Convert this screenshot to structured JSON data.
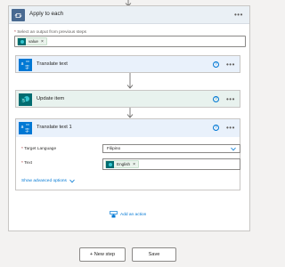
{
  "apply_to_each": {
    "title": "Apply to each",
    "select_label": "Select an output from previous steps",
    "select_required_marker": "*",
    "select_token": "value"
  },
  "actions": {
    "translate_text": {
      "title": "Translate text",
      "icon": "translator-icon",
      "color": "#0078d4"
    },
    "update_item": {
      "title": "Update item",
      "icon": "sharepoint-icon",
      "color": "#036c70"
    },
    "translate_text_1": {
      "title": "Translate text 1",
      "icon": "translator-icon",
      "color": "#0078d4",
      "target_language_label": "Target Language",
      "target_language_value": "Filipino",
      "text_label": "Text",
      "text_token": "English",
      "advanced_label": "Show advanced options"
    }
  },
  "help_glyph": "?",
  "menu_glyph": "•••",
  "token_remove_glyph": "×",
  "required_marker": "*",
  "add_action_label": "Add an action",
  "footer": {
    "new_step_label": "+ New step",
    "save_label": "Save"
  },
  "colors": {
    "accent": "#0078d4",
    "loop_header": "#486991",
    "sharepoint": "#036c70",
    "required": "#a4262c"
  }
}
